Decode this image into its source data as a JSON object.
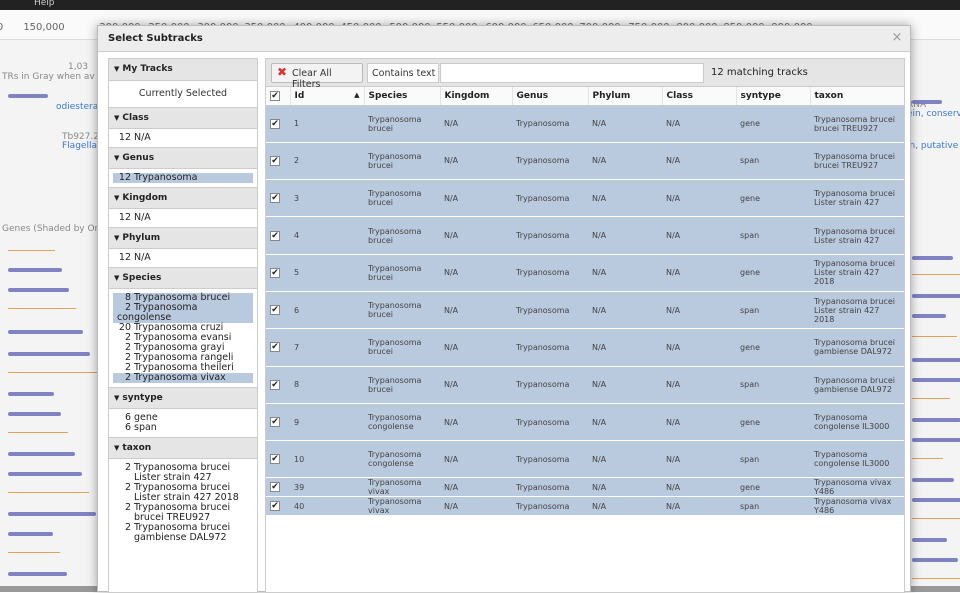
{
  "background": {
    "menu_label": "Help",
    "ruler_ticks": [
      "0",
      "150,000",
      "200,000",
      "250,000",
      "300,000",
      "350,000",
      "400,000",
      "450,000",
      "500,000",
      "550,000",
      "600,000",
      "650,000",
      "700,000",
      "750,000",
      "800,000",
      "850,000",
      "900,000"
    ],
    "left_texts": [
      "TRs in Gray when av",
      "1,03",
      "odiesterase (Tdp1), p",
      "Tb927.2.",
      "Flagellar",
      "Genes (Shaded by Or"
    ],
    "right_texts": [
      "RNA",
      "ein, conserv",
      "in, putative"
    ]
  },
  "dialog": {
    "title": "Select Subtracks",
    "close_glyph": "×"
  },
  "sidebar": {
    "my_tracks": {
      "title": "My Tracks",
      "item": "Currently Selected"
    },
    "class": {
      "title": "Class",
      "items": [
        {
          "count": "12",
          "label": "N/A",
          "selected": false
        }
      ]
    },
    "genus": {
      "title": "Genus",
      "items": [
        {
          "count": "12",
          "label": "Trypanosoma",
          "selected": true
        }
      ]
    },
    "kingdom": {
      "title": "Kingdom",
      "items": [
        {
          "count": "12",
          "label": "N/A",
          "selected": false
        }
      ]
    },
    "phylum": {
      "title": "Phylum",
      "items": [
        {
          "count": "12",
          "label": "N/A",
          "selected": false
        }
      ]
    },
    "species": {
      "title": "Species",
      "items": [
        {
          "count": "8",
          "label": "Trypanosoma brucei",
          "selected": true
        },
        {
          "count": "2",
          "label": "Trypanosoma congolense",
          "selected": true
        },
        {
          "count": "20",
          "label": "Trypanosoma cruzi",
          "selected": false
        },
        {
          "count": "2",
          "label": "Trypanosoma evansi",
          "selected": false
        },
        {
          "count": "2",
          "label": "Trypanosoma grayi",
          "selected": false
        },
        {
          "count": "2",
          "label": "Trypanosoma rangeli",
          "selected": false
        },
        {
          "count": "2",
          "label": "Trypanosoma theileri",
          "selected": false
        },
        {
          "count": "2",
          "label": "Trypanosoma vivax",
          "selected": true
        }
      ]
    },
    "syntype": {
      "title": "syntype",
      "items": [
        {
          "count": "6",
          "label": "gene",
          "selected": false
        },
        {
          "count": "6",
          "label": "span",
          "selected": false
        }
      ]
    },
    "taxon": {
      "title": "taxon",
      "items": [
        {
          "count": "2",
          "label": "Trypanosoma brucei Lister strain 427"
        },
        {
          "count": "2",
          "label": "Trypanosoma brucei Lister strain 427 2018"
        },
        {
          "count": "2",
          "label": "Trypanosoma brucei brucei TREU927"
        },
        {
          "count": "2",
          "label": "Trypanosoma brucei gambiense DAL972"
        }
      ]
    }
  },
  "toolbar": {
    "clear_label": "Clear All Filters",
    "contains_label": "Contains text",
    "filter_value": "",
    "match_count": "12 matching tracks"
  },
  "table": {
    "columns": [
      "Id",
      "Species",
      "Kingdom",
      "Genus",
      "Phylum",
      "Class",
      "syntype",
      "taxon"
    ],
    "sort_indicator": "▲",
    "checkbox_mark": "✔",
    "rows": [
      {
        "id": "1",
        "species": "Trypanosoma brucei",
        "kingdom": "N/A",
        "genus": "Trypanosoma",
        "phylum": "N/A",
        "class": "N/A",
        "syntype": "gene",
        "taxon": "Trypanosoma brucei brucei TREU927"
      },
      {
        "id": "2",
        "species": "Trypanosoma brucei",
        "kingdom": "N/A",
        "genus": "Trypanosoma",
        "phylum": "N/A",
        "class": "N/A",
        "syntype": "span",
        "taxon": "Trypanosoma brucei brucei TREU927"
      },
      {
        "id": "3",
        "species": "Trypanosoma brucei",
        "kingdom": "N/A",
        "genus": "Trypanosoma",
        "phylum": "N/A",
        "class": "N/A",
        "syntype": "gene",
        "taxon": "Trypanosoma brucei Lister strain 427"
      },
      {
        "id": "4",
        "species": "Trypanosoma brucei",
        "kingdom": "N/A",
        "genus": "Trypanosoma",
        "phylum": "N/A",
        "class": "N/A",
        "syntype": "span",
        "taxon": "Trypanosoma brucei Lister strain 427"
      },
      {
        "id": "5",
        "species": "Trypanosoma brucei",
        "kingdom": "N/A",
        "genus": "Trypanosoma",
        "phylum": "N/A",
        "class": "N/A",
        "syntype": "gene",
        "taxon": "Trypanosoma brucei Lister strain 427 2018"
      },
      {
        "id": "6",
        "species": "Trypanosoma brucei",
        "kingdom": "N/A",
        "genus": "Trypanosoma",
        "phylum": "N/A",
        "class": "N/A",
        "syntype": "span",
        "taxon": "Trypanosoma brucei Lister strain 427 2018"
      },
      {
        "id": "7",
        "species": "Trypanosoma brucei",
        "kingdom": "N/A",
        "genus": "Trypanosoma",
        "phylum": "N/A",
        "class": "N/A",
        "syntype": "gene",
        "taxon": "Trypanosoma brucei gambiense DAL972"
      },
      {
        "id": "8",
        "species": "Trypanosoma brucei",
        "kingdom": "N/A",
        "genus": "Trypanosoma",
        "phylum": "N/A",
        "class": "N/A",
        "syntype": "span",
        "taxon": "Trypanosoma brucei gambiense DAL972"
      },
      {
        "id": "9",
        "species": "Trypanosoma congolense",
        "kingdom": "N/A",
        "genus": "Trypanosoma",
        "phylum": "N/A",
        "class": "N/A",
        "syntype": "gene",
        "taxon": "Trypanosoma congolense IL3000"
      },
      {
        "id": "10",
        "species": "Trypanosoma congolense",
        "kingdom": "N/A",
        "genus": "Trypanosoma",
        "phylum": "N/A",
        "class": "N/A",
        "syntype": "span",
        "taxon": "Trypanosoma congolense IL3000"
      },
      {
        "id": "39",
        "species": "Trypanosoma vivax",
        "kingdom": "N/A",
        "genus": "Trypanosoma",
        "phylum": "N/A",
        "class": "N/A",
        "syntype": "gene",
        "taxon": "Trypanosoma vivax Y486"
      },
      {
        "id": "40",
        "species": "Trypanosoma vivax",
        "kingdom": "N/A",
        "genus": "Trypanosoma",
        "phylum": "N/A",
        "class": "N/A",
        "syntype": "span",
        "taxon": "Trypanosoma vivax Y486"
      }
    ]
  },
  "colors": {
    "selected_row": "#b9c9de",
    "clear_icon": "#dd3333",
    "track_feature": "#7f83c4"
  }
}
